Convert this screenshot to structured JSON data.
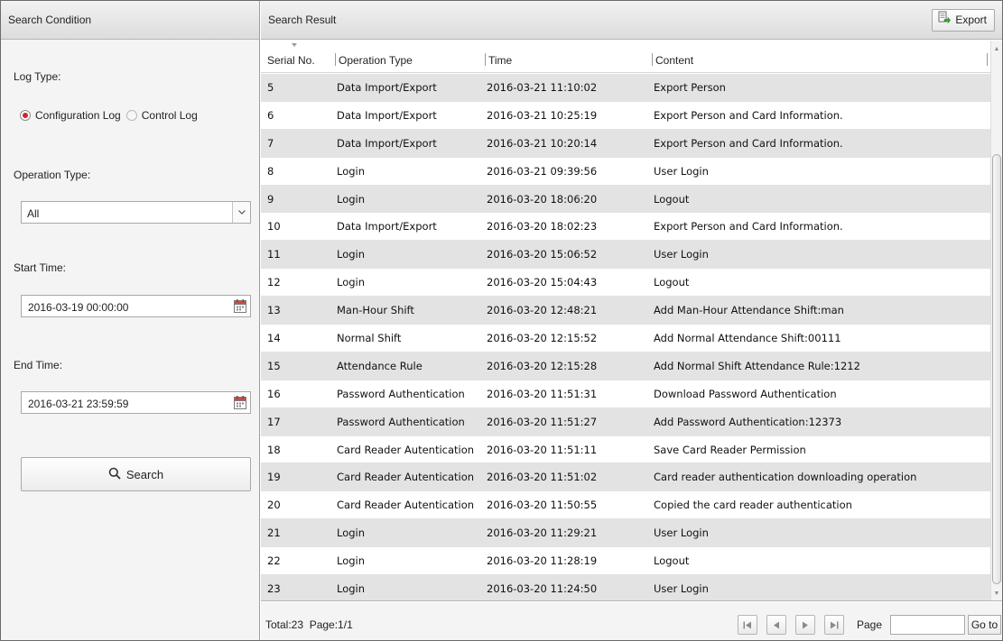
{
  "search_condition": {
    "title": "Search Condition",
    "log_type_label": "Log Type:",
    "log_types": [
      {
        "label": "Configuration Log",
        "checked": true
      },
      {
        "label": "Control Log",
        "checked": false
      }
    ],
    "operation_type_label": "Operation Type:",
    "operation_type_value": "All",
    "start_time_label": "Start Time:",
    "start_time_value": "2016-03-19 00:00:00",
    "end_time_label": "End Time:",
    "end_time_value": "2016-03-21 23:59:59",
    "search_label": "Search"
  },
  "search_result": {
    "title": "Search Result",
    "export_label": "Export",
    "columns": [
      "Serial No.",
      "Operation Type",
      "Time",
      "Content"
    ],
    "rows": [
      [
        "5",
        "Data Import/Export",
        "2016-03-21 11:10:02",
        "Export Person"
      ],
      [
        "6",
        "Data Import/Export",
        "2016-03-21 10:25:19",
        "Export Person and Card Information."
      ],
      [
        "7",
        "Data Import/Export",
        "2016-03-21 10:20:14",
        "Export Person and Card Information."
      ],
      [
        "8",
        "Login",
        "2016-03-21 09:39:56",
        "User Login"
      ],
      [
        "9",
        "Login",
        "2016-03-20 18:06:20",
        "Logout"
      ],
      [
        "10",
        "Data Import/Export",
        "2016-03-20 18:02:23",
        "Export Person and Card Information."
      ],
      [
        "11",
        "Login",
        "2016-03-20 15:06:52",
        "User Login"
      ],
      [
        "12",
        "Login",
        "2016-03-20 15:04:43",
        "Logout"
      ],
      [
        "13",
        "Man-Hour Shift",
        "2016-03-20 12:48:21",
        "Add Man-Hour Attendance Shift:man"
      ],
      [
        "14",
        "Normal Shift",
        "2016-03-20 12:15:52",
        "Add Normal Attendance Shift:00111"
      ],
      [
        "15",
        "Attendance Rule",
        "2016-03-20 12:15:28",
        "Add Normal Shift Attendance Rule:1212"
      ],
      [
        "16",
        "Password Authentication",
        "2016-03-20 11:51:31",
        "Download Password Authentication"
      ],
      [
        "17",
        "Password Authentication",
        "2016-03-20 11:51:27",
        "Add Password Authentication:12373"
      ],
      [
        "18",
        "Card Reader Autentication",
        "2016-03-20 11:51:11",
        "Save Card Reader Permission"
      ],
      [
        "19",
        "Card Reader Autentication",
        "2016-03-20 11:51:02",
        "Card reader authentication downloading operation"
      ],
      [
        "20",
        "Card Reader Autentication",
        "2016-03-20 11:50:55",
        "Copied the card reader authentication"
      ],
      [
        "21",
        "Login",
        "2016-03-20 11:29:21",
        "User Login"
      ],
      [
        "22",
        "Login",
        "2016-03-20 11:28:19",
        "Logout"
      ],
      [
        "23",
        "Login",
        "2016-03-20 11:24:50",
        "User Login"
      ]
    ],
    "total_text": "Total:23  Page:1/1",
    "page_label": "Page",
    "page_input_value": "",
    "goto_label": "Go to"
  },
  "colors": {
    "accent_radio": "#d2232a",
    "row_alt": "#e3e3e3",
    "header_bg": "#e6e6e6"
  }
}
